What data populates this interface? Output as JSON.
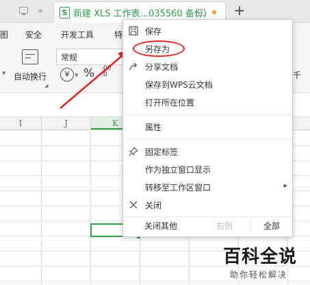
{
  "tabbar": {
    "active_tab_title": "新建 XLS 工作表...035560 备份)",
    "active_tab_icon": "S",
    "add_tab_label": "+"
  },
  "ribbon": {
    "menu": [
      "图",
      "安全",
      "开发工具",
      "特"
    ],
    "wrap_text_label": "自动换行",
    "number_format": "常规",
    "currency_symbol": "¥",
    "percent_symbol": "%",
    "decimal_increase": ".00\n.0",
    "right_partial": "千"
  },
  "sheet": {
    "columns": [
      "I",
      "J",
      "K"
    ],
    "selected_column": "K"
  },
  "context_menu": {
    "items": [
      {
        "label": "保存",
        "icon": "save-icon"
      },
      {
        "label": "另存为",
        "icon": ""
      },
      {
        "label": "分享文档",
        "icon": "share-icon"
      },
      {
        "label": "保存到WPS云文档",
        "icon": ""
      },
      {
        "label": "打开所在位置",
        "icon": ""
      },
      {
        "label": "属性",
        "icon": ""
      },
      {
        "label": "固定标签",
        "icon": "pin-icon"
      },
      {
        "label": "作为独立窗口显示",
        "icon": ""
      },
      {
        "label": "转移至工作区窗口",
        "icon": "",
        "submenu": true
      },
      {
        "label": "关闭",
        "icon": "close-icon"
      }
    ],
    "bottom": {
      "close_others": "关闭其他",
      "right": "右侧",
      "all": "全部"
    }
  },
  "watermark": {
    "title": "百科全说",
    "subtitle": "助你轻松解决"
  },
  "colors": {
    "accent_green": "#2f9e45",
    "annotation_red": "#e02424",
    "orange_dot": "#f39c38"
  }
}
